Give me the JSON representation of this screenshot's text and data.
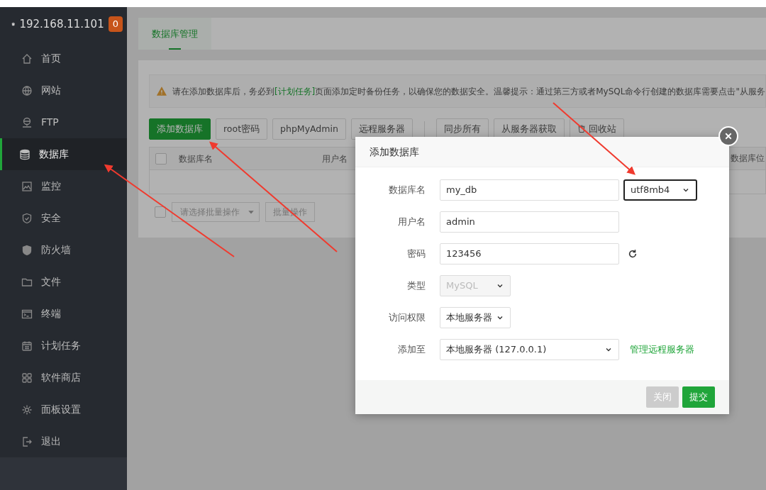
{
  "sidebar": {
    "host": "192.168.11.101",
    "badge": "0",
    "items": [
      {
        "label": "首页",
        "kind": "home",
        "selected": false
      },
      {
        "label": "网站",
        "kind": "globe",
        "selected": false
      },
      {
        "label": "FTP",
        "kind": "ftp",
        "selected": false
      },
      {
        "label": "数据库",
        "kind": "database",
        "selected": true
      },
      {
        "label": "监控",
        "kind": "monitor",
        "selected": false
      },
      {
        "label": "安全",
        "kind": "shield",
        "selected": false
      },
      {
        "label": "防火墙",
        "kind": "firewall",
        "selected": false
      },
      {
        "label": "文件",
        "kind": "folder",
        "selected": false
      },
      {
        "label": "终端",
        "kind": "terminal",
        "selected": false
      },
      {
        "label": "计划任务",
        "kind": "calendar",
        "selected": false
      },
      {
        "label": "软件商店",
        "kind": "grid",
        "selected": false
      },
      {
        "label": "面板设置",
        "kind": "gear",
        "selected": false
      },
      {
        "label": "退出",
        "kind": "logout",
        "selected": false
      }
    ]
  },
  "tabs": [
    {
      "label": "数据库管理",
      "selected": true
    }
  ],
  "notice": {
    "before": "请在添加数据库后，务必到",
    "link": "[计划任务]",
    "after": "页面添加定时备份任务，以确保您的数据安全。温馨提示：通过第三方或者MySQL命令行创建的数据库需要点击\"从服务"
  },
  "toolbar": [
    {
      "label": "添加数据库",
      "kind": "primary"
    },
    {
      "label": "root密码",
      "kind": "default"
    },
    {
      "label": "phpMyAdmin",
      "kind": "default"
    },
    {
      "label": "远程服务器",
      "kind": "default"
    },
    {
      "label": "同步所有",
      "kind": "separated"
    },
    {
      "label": "从服务器获取",
      "kind": "default"
    },
    {
      "label": "回收站",
      "kind": "trash"
    }
  ],
  "table": {
    "select_all": {
      "checked": false
    },
    "columns": [
      "数据库名",
      "用户名",
      "数据库位"
    ]
  },
  "batch": {
    "checked": false,
    "select": "请选择批量操作",
    "button": "批量操作"
  },
  "dialog": {
    "title": "添加数据库",
    "fields": [
      {
        "label": "数据库名",
        "kind": "text",
        "value": "my_db",
        "disabled": false,
        "addon": {
          "kind": "select",
          "value": "utf8mb4"
        }
      },
      {
        "label": "用户名",
        "kind": "text",
        "value": "admin",
        "disabled": false
      },
      {
        "label": "密码",
        "kind": "text",
        "value": "123456",
        "disabled": false,
        "addon": {
          "kind": "refresh"
        }
      },
      {
        "label": "类型",
        "kind": "select",
        "value": "MySQL",
        "disabled": true
      },
      {
        "label": "访问权限",
        "kind": "select",
        "value": "本地服务器",
        "disabled": false
      },
      {
        "label": "添加至",
        "kind": "wide_select",
        "value": "本地服务器 (127.0.0.1)",
        "disabled": false,
        "addon": {
          "kind": "link",
          "label": "管理远程服务器"
        }
      }
    ],
    "buttons": [
      {
        "label": "关闭",
        "kind": "close"
      },
      {
        "label": "提交",
        "kind": "submit"
      }
    ]
  }
}
